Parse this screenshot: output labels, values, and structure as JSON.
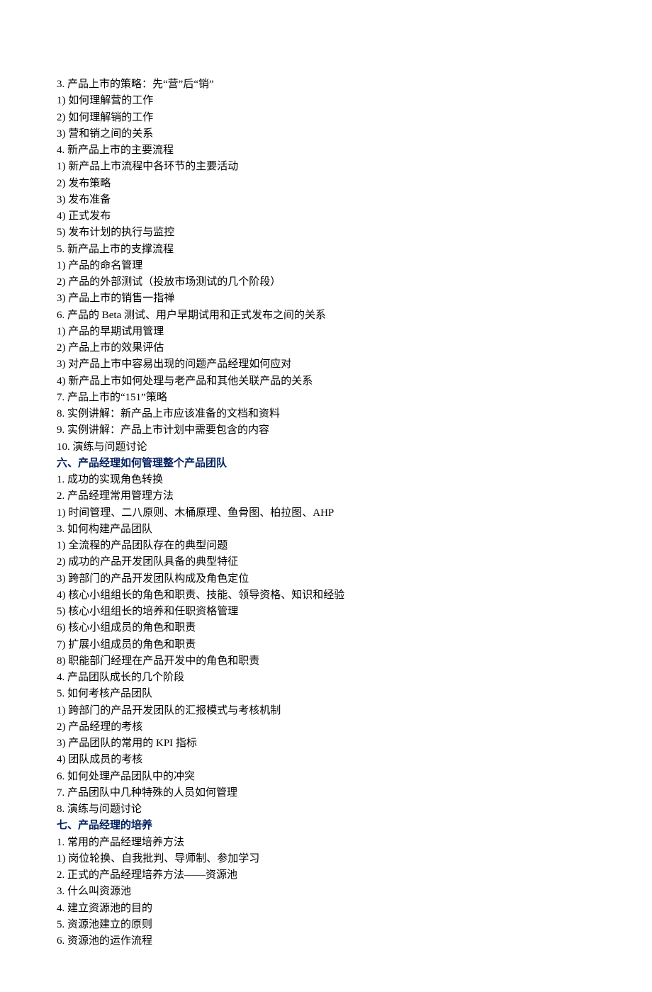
{
  "lines": [
    {
      "text": "3. 产品上市的策略：先“营”后“销”",
      "heading": false
    },
    {
      "text": "1) 如何理解营的工作",
      "heading": false
    },
    {
      "text": "2) 如何理解销的工作",
      "heading": false
    },
    {
      "text": "3) 营和销之间的关系",
      "heading": false
    },
    {
      "text": "4. 新产品上市的主要流程",
      "heading": false
    },
    {
      "text": "1) 新产品上市流程中各环节的主要活动",
      "heading": false
    },
    {
      "text": "2) 发布策略",
      "heading": false
    },
    {
      "text": "3) 发布准备",
      "heading": false
    },
    {
      "text": "4) 正式发布",
      "heading": false
    },
    {
      "text": "5) 发布计划的执行与监控",
      "heading": false
    },
    {
      "text": "5. 新产品上市的支撑流程",
      "heading": false
    },
    {
      "text": "1) 产品的命名管理",
      "heading": false
    },
    {
      "text": "2) 产品的外部测试（投放市场测试的几个阶段）",
      "heading": false
    },
    {
      "text": "3) 产品上市的销售一指禅",
      "heading": false
    },
    {
      "text": "6. 产品的 Beta 测试、用户早期试用和正式发布之间的关系",
      "heading": false
    },
    {
      "text": "1) 产品的早期试用管理",
      "heading": false
    },
    {
      "text": "2) 产品上市的效果评估",
      "heading": false
    },
    {
      "text": "3) 对产品上市中容易出现的问题产品经理如何应对",
      "heading": false
    },
    {
      "text": "4) 新产品上市如何处理与老产品和其他关联产品的关系",
      "heading": false
    },
    {
      "text": "7. 产品上市的“151”策略",
      "heading": false
    },
    {
      "text": "8. 实例讲解：新产品上市应该准备的文档和资料",
      "heading": false
    },
    {
      "text": "9. 实例讲解：产品上市计划中需要包含的内容",
      "heading": false
    },
    {
      "text": "10. 演练与问题讨论",
      "heading": false
    },
    {
      "text": "六、产品经理如何管理整个产品团队",
      "heading": true
    },
    {
      "text": "1. 成功的实现角色转换",
      "heading": false
    },
    {
      "text": "2. 产品经理常用管理方法",
      "heading": false
    },
    {
      "text": "1) 时间管理、二八原则、木桶原理、鱼骨图、柏拉图、AHP",
      "heading": false
    },
    {
      "text": "3. 如何构建产品团队",
      "heading": false
    },
    {
      "text": "1) 全流程的产品团队存在的典型问题",
      "heading": false
    },
    {
      "text": "2) 成功的产品开发团队具备的典型特征",
      "heading": false
    },
    {
      "text": "3) 跨部门的产品开发团队构成及角色定位",
      "heading": false
    },
    {
      "text": "4) 核心小组组长的角色和职责、技能、领导资格、知识和经验",
      "heading": false
    },
    {
      "text": "5) 核心小组组长的培养和任职资格管理",
      "heading": false
    },
    {
      "text": "6) 核心小组成员的角色和职责",
      "heading": false
    },
    {
      "text": "7) 扩展小组成员的角色和职责",
      "heading": false
    },
    {
      "text": "8) 职能部门经理在产品开发中的角色和职责",
      "heading": false
    },
    {
      "text": "4. 产品团队成长的几个阶段",
      "heading": false
    },
    {
      "text": "5. 如何考核产品团队",
      "heading": false
    },
    {
      "text": "1) 跨部门的产品开发团队的汇报模式与考核机制",
      "heading": false
    },
    {
      "text": "2) 产品经理的考核",
      "heading": false
    },
    {
      "text": "3) 产品团队的常用的 KPI 指标",
      "heading": false
    },
    {
      "text": "4) 团队成员的考核",
      "heading": false
    },
    {
      "text": "6. 如何处理产品团队中的冲突",
      "heading": false
    },
    {
      "text": "7. 产品团队中几种特殊的人员如何管理",
      "heading": false
    },
    {
      "text": "8. 演练与问题讨论",
      "heading": false
    },
    {
      "text": "七、产品经理的培养",
      "heading": true
    },
    {
      "text": "1. 常用的产品经理培养方法",
      "heading": false
    },
    {
      "text": "1) 岗位轮换、自我批判、导师制、参加学习",
      "heading": false
    },
    {
      "text": "2. 正式的产品经理培养方法――资源池",
      "heading": false
    },
    {
      "text": "3. 什么叫资源池",
      "heading": false
    },
    {
      "text": "4. 建立资源池的目的",
      "heading": false
    },
    {
      "text": "5. 资源池建立的原则",
      "heading": false
    },
    {
      "text": "6. 资源池的运作流程",
      "heading": false
    }
  ]
}
